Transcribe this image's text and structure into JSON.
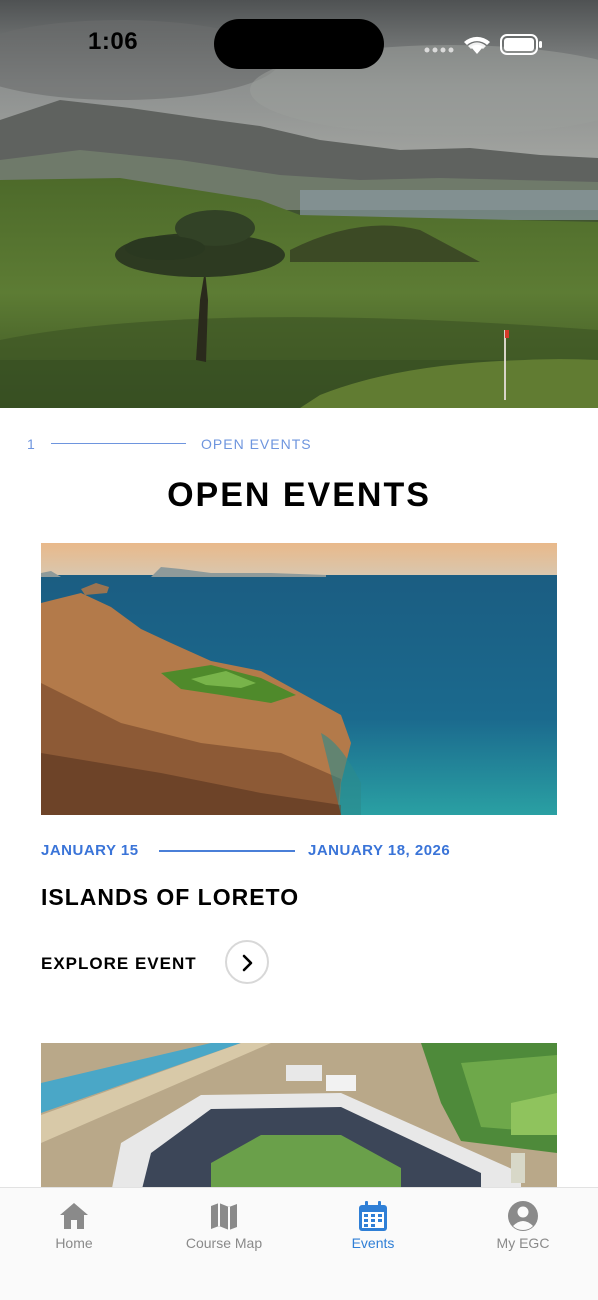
{
  "status_bar": {
    "time": "1:06"
  },
  "section": {
    "index": "1",
    "label": "OPEN EVENTS"
  },
  "page": {
    "title": "OPEN EVENTS"
  },
  "events": [
    {
      "start_date": "JANUARY 15",
      "end_date": "JANUARY 18, 2026",
      "name": "ISLANDS OF LORETO",
      "cta": "EXPLORE EVENT"
    }
  ],
  "tabbar": {
    "items": [
      {
        "label": "Home",
        "icon": "home-icon",
        "active": false
      },
      {
        "label": "Course Map",
        "icon": "map-icon",
        "active": false
      },
      {
        "label": "Events",
        "icon": "calendar-icon",
        "active": true
      },
      {
        "label": "My EGC",
        "icon": "account-icon",
        "active": false
      }
    ]
  },
  "colors": {
    "accent_blue": "#3a74d8",
    "section_blue": "#6e95de",
    "tab_active": "#2f7fd6",
    "tab_inactive": "#8a8a8a"
  }
}
